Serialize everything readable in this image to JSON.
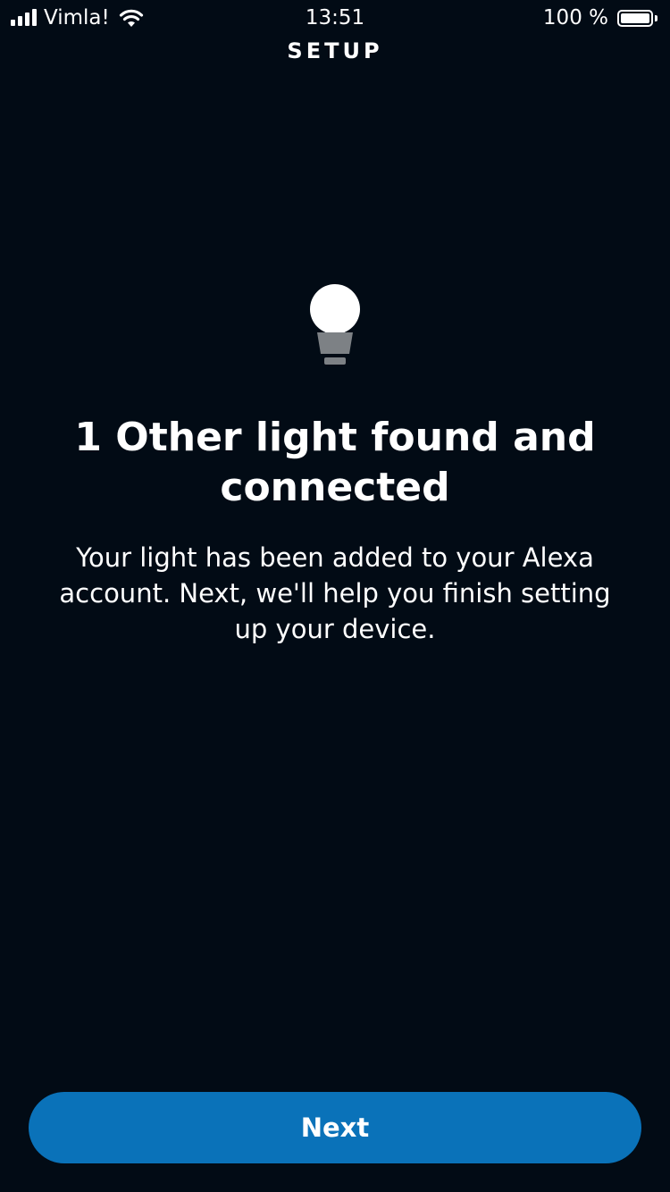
{
  "status_bar": {
    "carrier": "Vimla!",
    "time": "13:51",
    "battery_percent": "100 %",
    "signal_bars": 4,
    "battery_level": 1.0
  },
  "header": {
    "title": "SETUP"
  },
  "main": {
    "icon": "lightbulb-icon",
    "title": "1 Other light found and connected",
    "description": "Your light has been added to your Alexa account. Next, we'll help you finish setting up your device."
  },
  "footer": {
    "next_label": "Next"
  },
  "colors": {
    "background": "#020b15",
    "accent": "#0a72b9",
    "text": "#ffffff",
    "bulb_base": "#7d8185"
  }
}
